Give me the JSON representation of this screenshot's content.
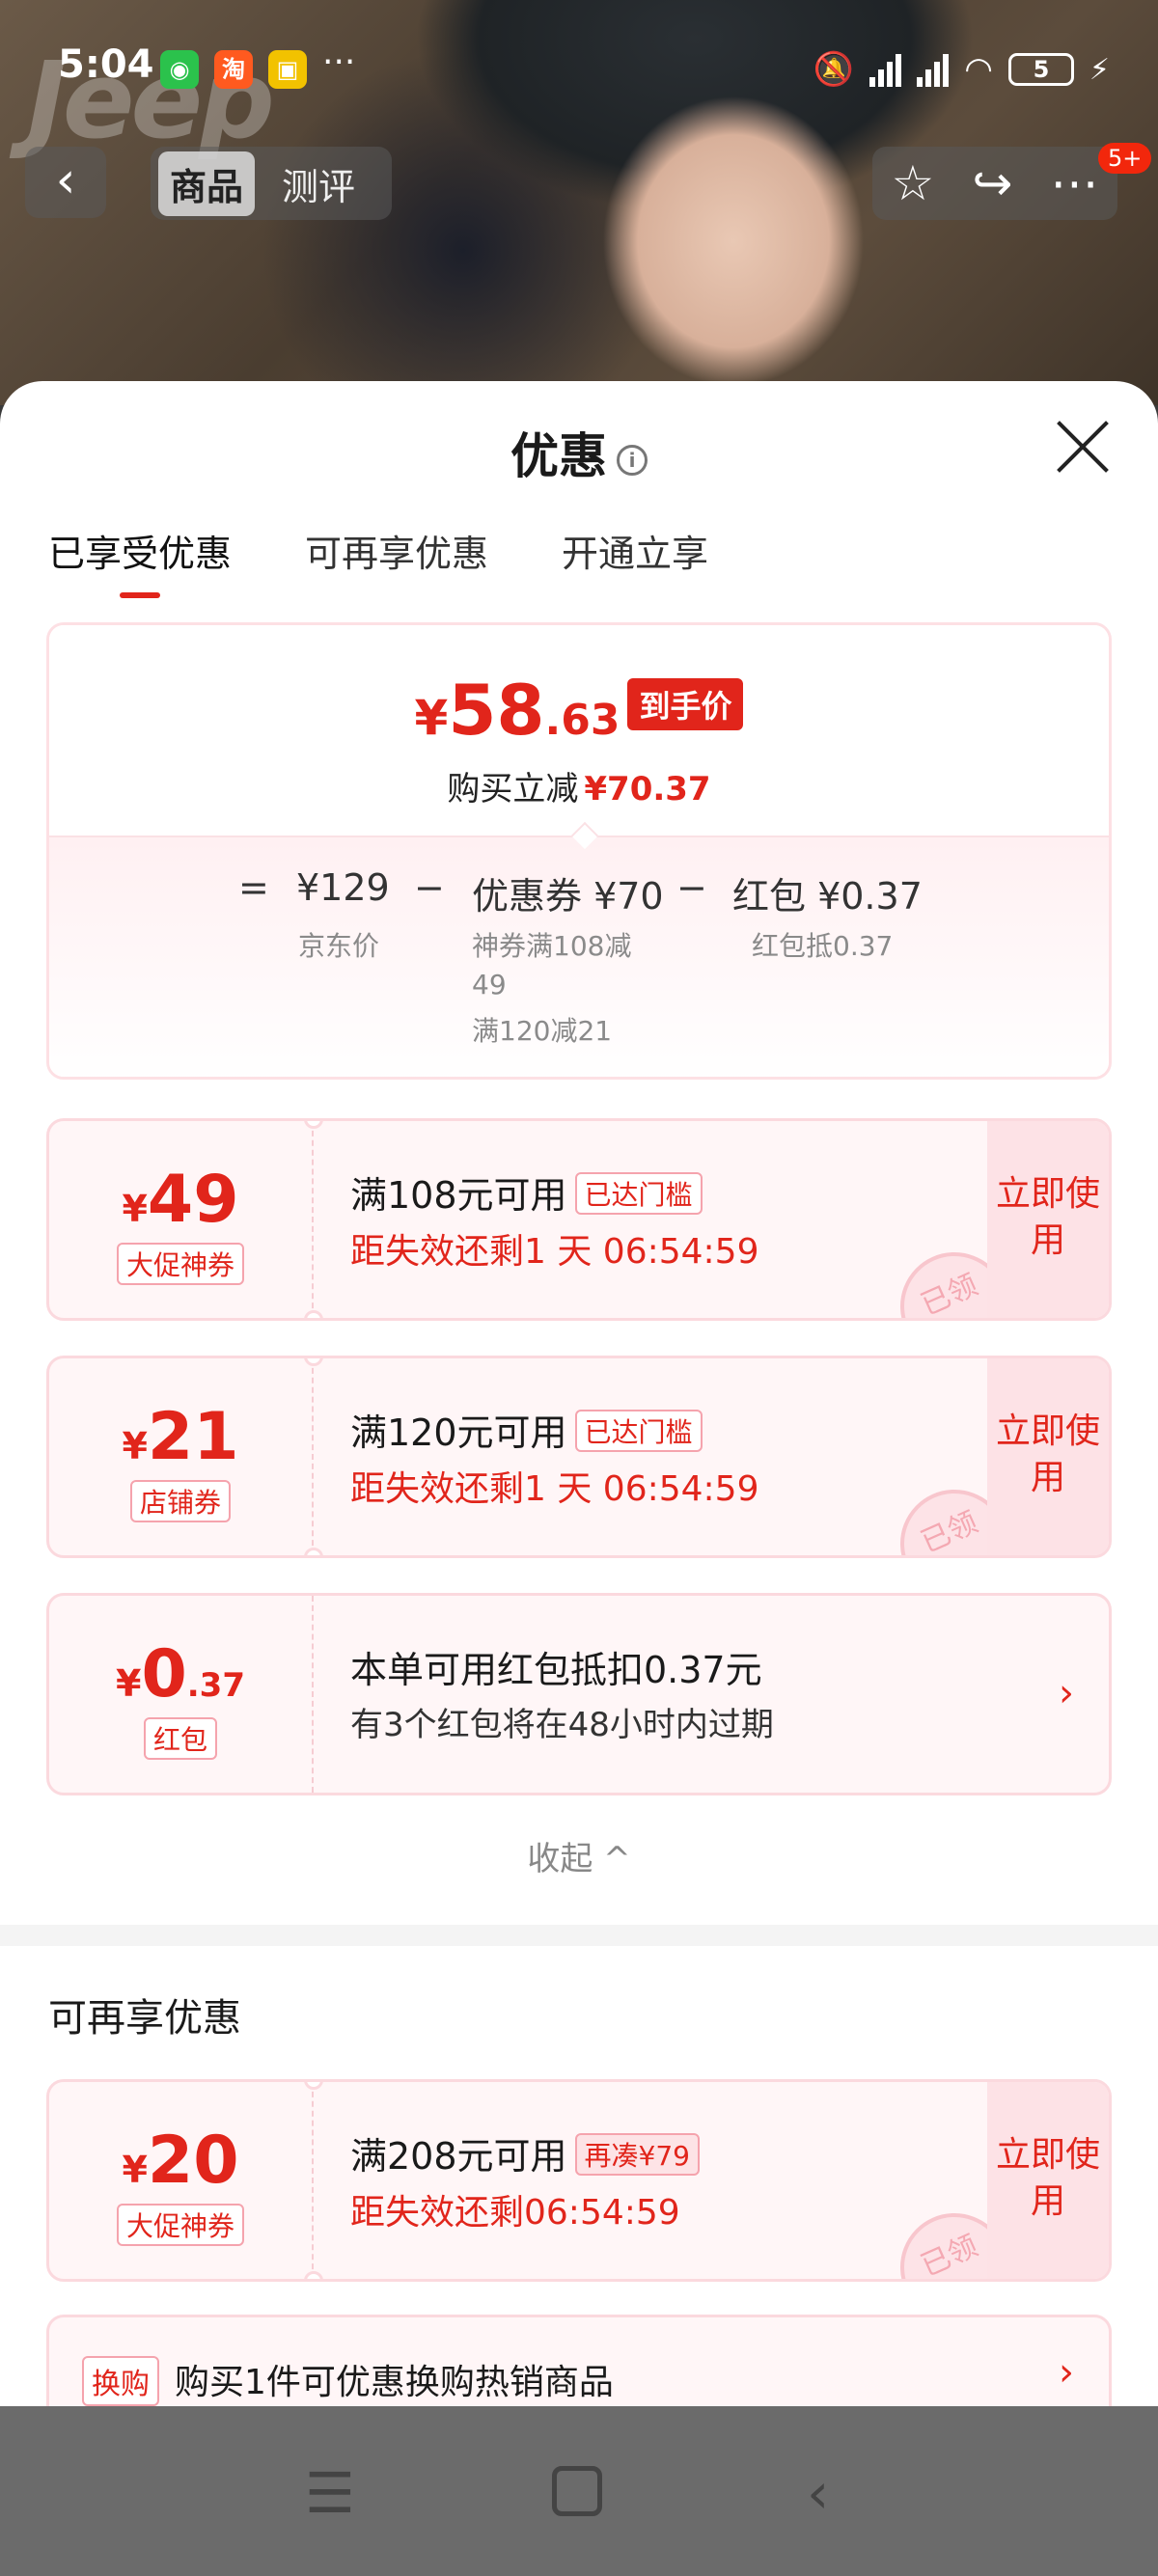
{
  "status_bar": {
    "time": "5:04",
    "app_icons": [
      "wechat-icon",
      "taobao-icon",
      "gift-icon"
    ],
    "more": "···",
    "battery": "5"
  },
  "product_nav": {
    "tabs": [
      "商品",
      "测评"
    ],
    "active_tab": "商品",
    "badge": "5+"
  },
  "sheet": {
    "title": "优惠",
    "tabs": [
      "已享受优惠",
      "可再享优惠",
      "开通立享"
    ],
    "active_tab": "已享受优惠"
  },
  "summary": {
    "price_symbol": "¥",
    "price_int": "58",
    "price_dec": ".63",
    "price_tag": "到手价",
    "reduce_label": "购买立减",
    "reduce_value": "¥70.37",
    "equals": "=",
    "base_price": "¥129",
    "base_label": "京东价",
    "minus1": "−",
    "coupon_label": "优惠券 ¥70",
    "coupon_detail1": "神券满108减",
    "coupon_detail2": "49",
    "coupon_detail3": "满120减21",
    "minus2": "−",
    "redpacket_label": "红包 ¥0.37",
    "redpacket_detail": "红包抵0.37"
  },
  "coupons": [
    {
      "symbol": "¥",
      "amount": "49",
      "amount_dec": "",
      "tag": "大促神券",
      "condition": "满108元可用",
      "badge": "已达门槛",
      "expiry": "距失效还剩1 天 06:54:59",
      "action": "立即使用",
      "stamp": "已领"
    },
    {
      "symbol": "¥",
      "amount": "21",
      "amount_dec": "",
      "tag": "店铺券",
      "condition": "满120元可用",
      "badge": "已达门槛",
      "expiry": "距失效还剩1 天 06:54:59",
      "action": "立即使用",
      "stamp": "已领"
    },
    {
      "symbol": "¥",
      "amount": "0",
      "amount_dec": ".37",
      "tag": "红包",
      "condition": "本单可用红包抵扣0.37元",
      "expiry": "有3个红包将在48小时内过期",
      "arrow": "›"
    }
  ],
  "collapse_label": "收起 ^",
  "more_section": {
    "title": "可再享优惠",
    "coupon": {
      "symbol": "¥",
      "amount": "20",
      "tag": "大促神券",
      "condition": "满208元可用",
      "badge": "再凑¥79",
      "expiry": "距失效还剩06:54:59",
      "action": "立即使用",
      "stamp": "已领"
    }
  },
  "swap": {
    "tag": "换购",
    "text": "购买1件可优惠换购热销商品",
    "arrow": "›"
  },
  "colors": {
    "accent": "#e1251b",
    "coupon_bg": "#fff6f7",
    "coupon_border": "#fbd9de"
  }
}
